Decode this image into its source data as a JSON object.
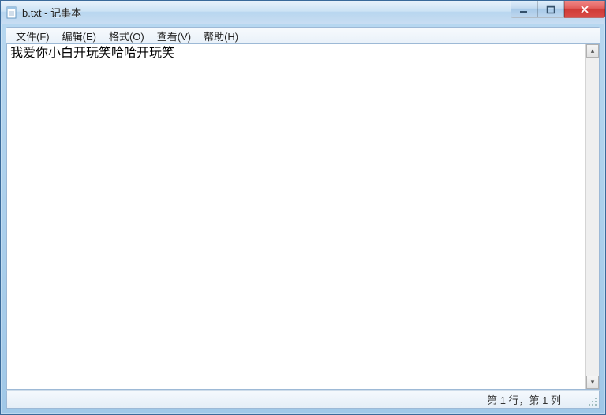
{
  "window": {
    "title": "b.txt - 记事本"
  },
  "menu": {
    "file": "文件(F)",
    "edit": "编辑(E)",
    "format": "格式(O)",
    "view": "查看(V)",
    "help": "帮助(H)"
  },
  "editor": {
    "content": "我爱你小白开玩笑哈哈开玩笑"
  },
  "status": {
    "position": "第 1 行，第 1 列"
  }
}
